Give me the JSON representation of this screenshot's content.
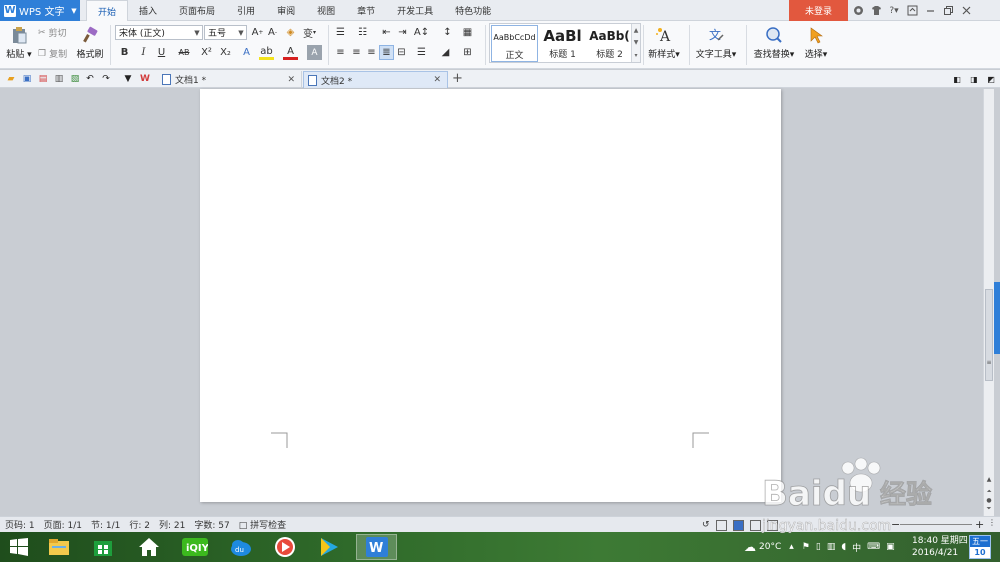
{
  "app": {
    "title": "WPS 文字"
  },
  "menu": {
    "tabs": [
      "开始",
      "插入",
      "页面布局",
      "引用",
      "审阅",
      "视图",
      "章节",
      "开发工具",
      "特色功能"
    ],
    "active_index": 0,
    "login_label": "未登录",
    "help_label": "?"
  },
  "ribbon": {
    "paste_label": "粘贴",
    "cut_label": "剪切",
    "copy_label": "复制",
    "format_painter_label": "格式刷",
    "font_name": "宋体 (正文)",
    "font_size": "五号",
    "bold": "B",
    "italic": "I",
    "underline": "U",
    "strike": "AB",
    "superscript": "X²",
    "subscript": "X₂",
    "styles": [
      {
        "sample": "AaBbCcDd",
        "name": "正文"
      },
      {
        "sample": "AaBl",
        "name": "标题 1"
      },
      {
        "sample": "AaBb(",
        "name": "标题 2"
      }
    ],
    "new_style_label": "新样式",
    "text_tools_label": "文字工具",
    "find_replace_label": "查找替换",
    "select_label": "选择"
  },
  "doc_tabs": [
    {
      "label": "文档1 *"
    },
    {
      "label": "文档2 *"
    }
  ],
  "status": {
    "page": "页码: 1",
    "pages": "页面: 1/1",
    "section": "节: 1/1",
    "row": "行: 2",
    "col": "列: 21",
    "words": "字数: 57",
    "spell": "拼写检查"
  },
  "taskbar": {
    "weather_temp": "20°C",
    "ime": "中",
    "time": "18:40 星期四",
    "date": "2016/4/21",
    "cal_weekday": "五一",
    "cal_day": "10"
  },
  "watermark": {
    "brand": "Baidu",
    "cn": "经验",
    "url": "jingyan.baidu.com"
  },
  "colors": {
    "accent": "#2f7fd8",
    "login": "#e2583e",
    "ribbon_bg": "#f8f9fb",
    "workspace_bg": "#c9cdd3"
  }
}
